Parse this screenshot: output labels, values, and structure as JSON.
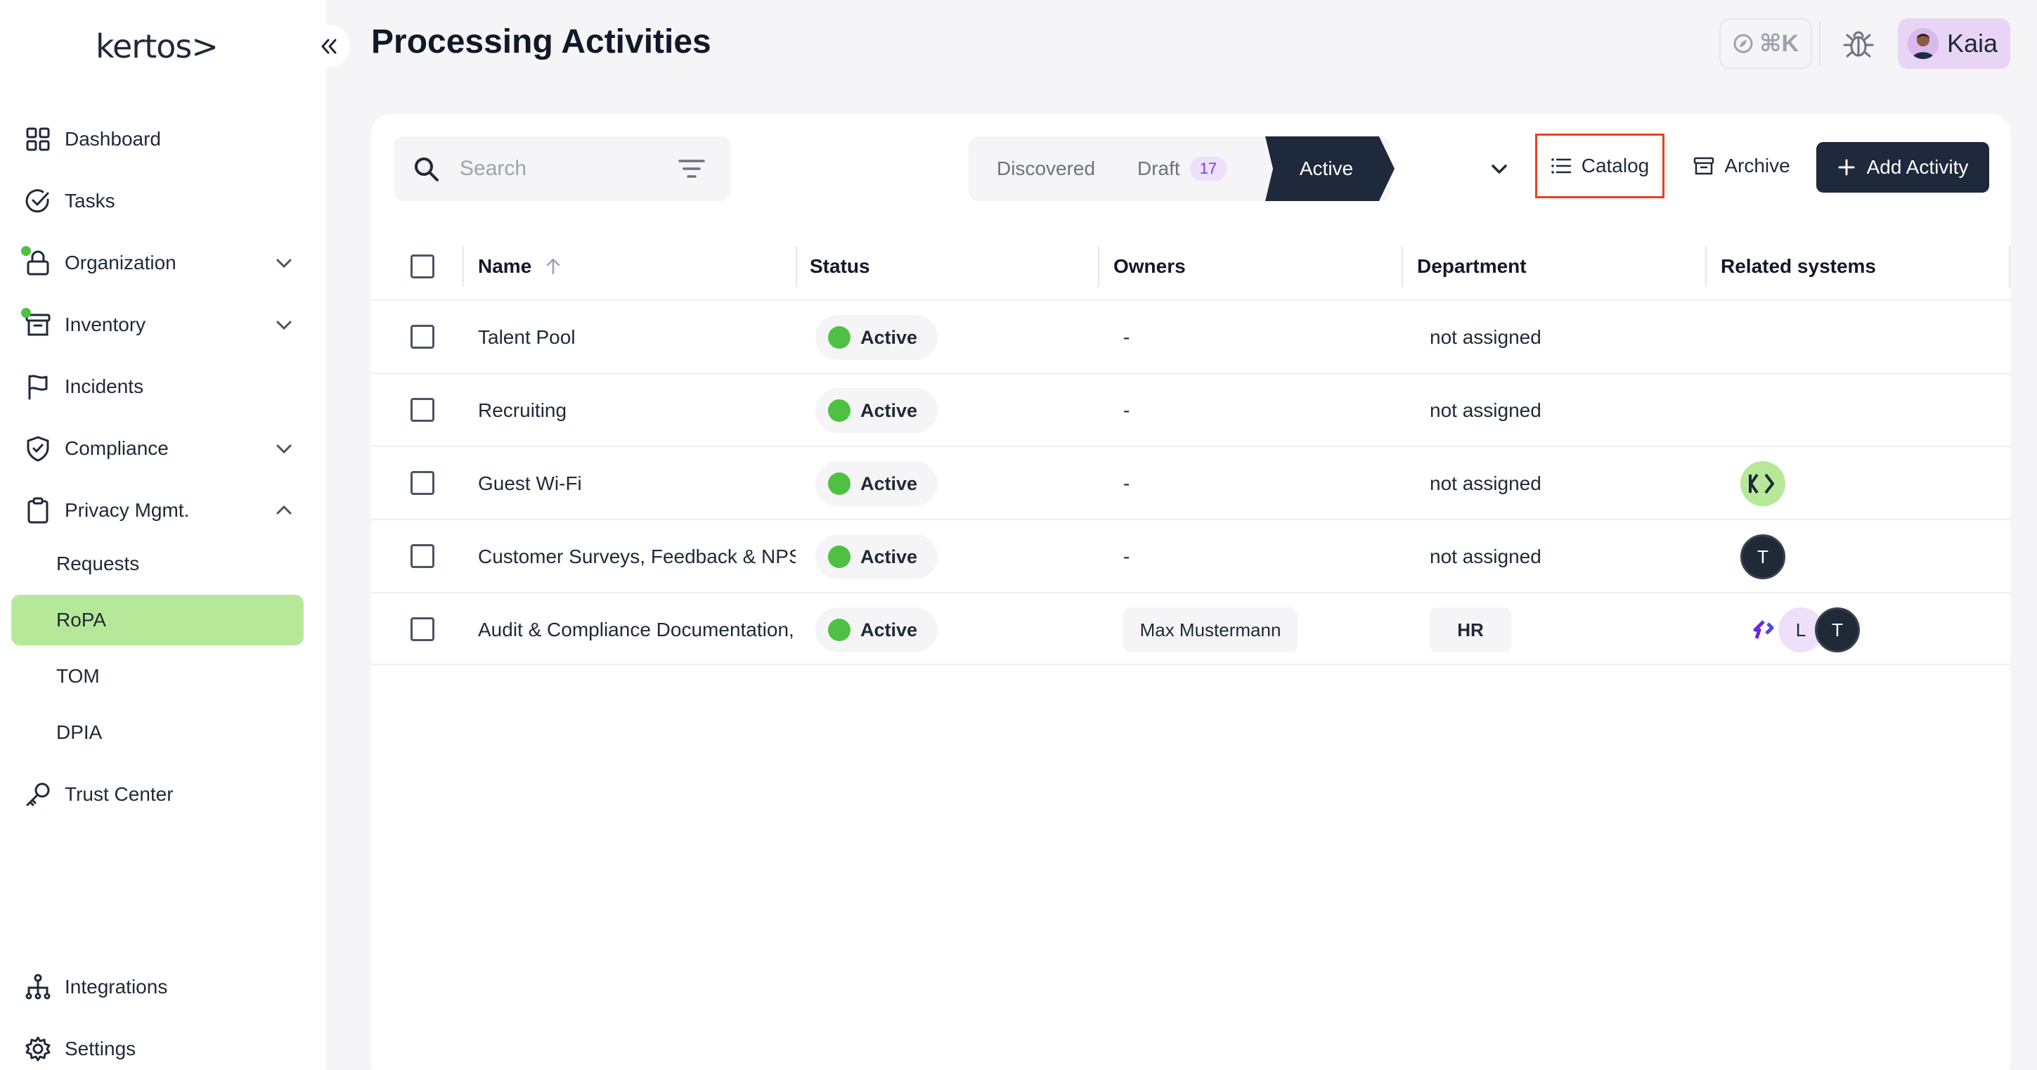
{
  "app": {
    "logo_text": "kertos>"
  },
  "sidebar": {
    "items": [
      {
        "label": "Dashboard",
        "icon": "grid-icon"
      },
      {
        "label": "Tasks",
        "icon": "check-circle-icon"
      },
      {
        "label": "Organization",
        "icon": "lock-icon",
        "expandable": true,
        "notify": true
      },
      {
        "label": "Inventory",
        "icon": "archive-box-icon",
        "expandable": true,
        "notify": true
      },
      {
        "label": "Incidents",
        "icon": "flag-icon"
      },
      {
        "label": "Compliance",
        "icon": "shield-check-icon",
        "expandable": true
      },
      {
        "label": "Privacy Mgmt.",
        "icon": "clipboard-icon",
        "expandable": true,
        "expanded": true
      }
    ],
    "sub_items": [
      {
        "label": "Requests"
      },
      {
        "label": "RoPA",
        "active": true
      },
      {
        "label": "TOM"
      },
      {
        "label": "DPIA"
      }
    ],
    "trust_center": "Trust Center",
    "integrations": "Integrations",
    "settings": "Settings"
  },
  "header": {
    "title": "Processing Activities",
    "shortcut": "⌘K",
    "user_name": "Kaia"
  },
  "toolbar": {
    "search_placeholder": "Search",
    "tabs": {
      "discovered": "Discovered",
      "draft": "Draft",
      "draft_count": "17",
      "active": "Active"
    },
    "catalog_label": "Catalog",
    "archive_label": "Archive",
    "add_label": "Add Activity"
  },
  "table": {
    "headers": {
      "name": "Name",
      "status": "Status",
      "owners": "Owners",
      "department": "Department",
      "related": "Related systems"
    },
    "rows": [
      {
        "name": "Talent Pool",
        "status": "Active",
        "owners": "-",
        "department": "not assigned",
        "department_chip": false,
        "owner_chip": false,
        "systems": []
      },
      {
        "name": "Recruiting",
        "status": "Active",
        "owners": "-",
        "department": "not assigned",
        "department_chip": false,
        "owner_chip": false,
        "systems": []
      },
      {
        "name": "Guest Wi-Fi",
        "status": "Active",
        "owners": "-",
        "department": "not assigned",
        "department_chip": false,
        "owner_chip": false,
        "systems": [
          "kertos-logo"
        ]
      },
      {
        "name": "Customer Surveys, Feedback & NPS",
        "status": "Active",
        "owners": "-",
        "department": "not assigned",
        "department_chip": false,
        "owner_chip": false,
        "systems": [
          "T"
        ]
      },
      {
        "name": "Audit & Compliance Documentation, I",
        "status": "Active",
        "owners": "Max Mustermann",
        "department": "HR",
        "department_chip": true,
        "owner_chip": true,
        "systems": [
          "purple-logo",
          "L",
          "T"
        ]
      }
    ]
  },
  "colors": {
    "accent_green": "#4ec043",
    "active_nav": "#b7e89a",
    "dark": "#1e293b",
    "highlight": "#e5421f"
  }
}
